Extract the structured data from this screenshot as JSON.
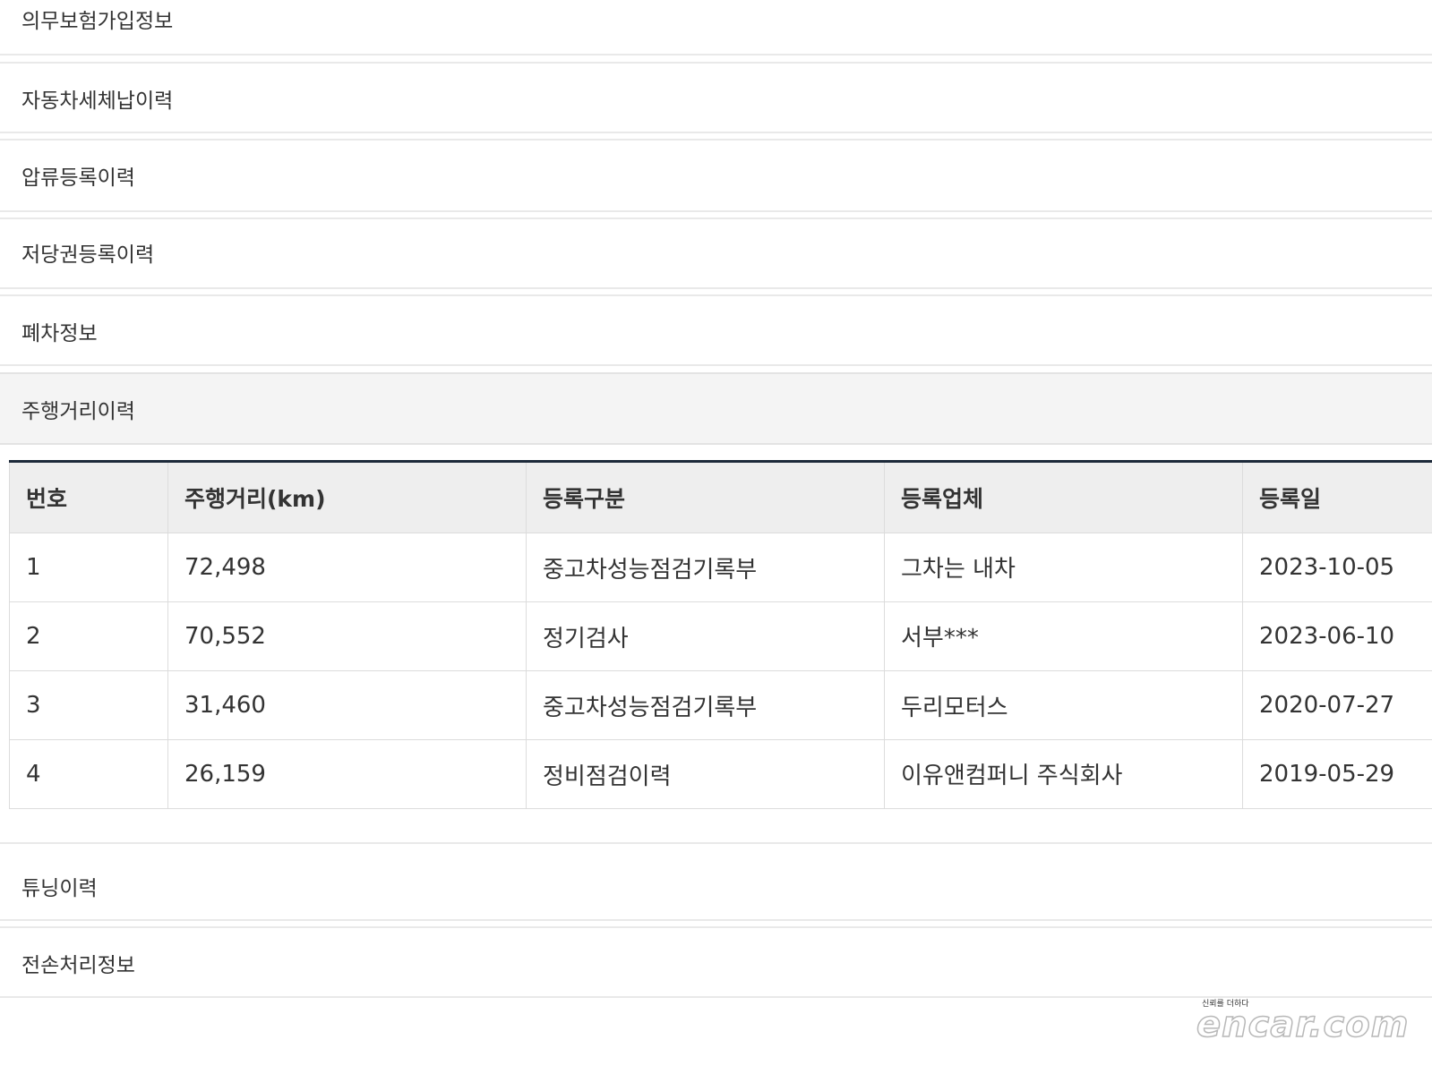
{
  "sections": {
    "insurance": "의무보험가입정보",
    "tax": "자동차세체납이력",
    "seizure": "압류등록이력",
    "mortgage": "저당권등록이력",
    "scrap": "폐차정보",
    "mileage": "주행거리이력",
    "tuning": "튜닝이력",
    "total_loss": "전손처리정보"
  },
  "mileage_table": {
    "headers": [
      "번호",
      "주행거리(km)",
      "등록구분",
      "등록업체",
      "등록일"
    ],
    "rows": [
      [
        "1",
        "72,498",
        "중고차성능점검기록부",
        "그차는 내차",
        "2023-10-05"
      ],
      [
        "2",
        "70,552",
        "정기검사",
        "서부***",
        "2023-06-10"
      ],
      [
        "3",
        "31,460",
        "중고차성능점검기록부",
        "두리모터스",
        "2020-07-27"
      ],
      [
        "4",
        "26,159",
        "정비점검이력",
        "이유앤컴퍼니 주식회사",
        "2019-05-29"
      ]
    ]
  },
  "logo": {
    "tagline": "신뢰를 더하다",
    "wordmark": "encar.com"
  }
}
